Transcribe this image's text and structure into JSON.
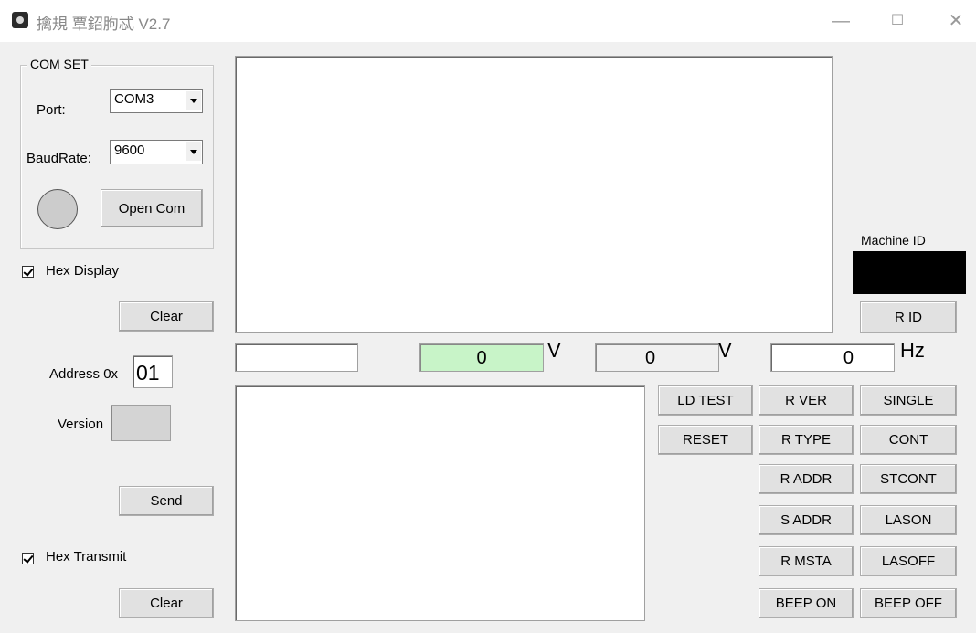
{
  "window": {
    "title": "擒規 覃鉊朐忒 V2.7",
    "min_glyph": "—",
    "max_glyph": "☐",
    "close_glyph": "✕"
  },
  "comset": {
    "group_title": "COM SET",
    "port_label": "Port:",
    "port_value": "COM3",
    "baud_label": "BaudRate:",
    "baud_value": "9600",
    "open_label": "Open Com"
  },
  "receive": {
    "hex_display_label": "Hex Display",
    "clear_label": "Clear",
    "text": ""
  },
  "device": {
    "address_label": "Address 0x",
    "address_value": "01",
    "version_label": "Version",
    "version_value": ""
  },
  "transmit": {
    "send_label": "Send",
    "hex_transmit_label": "Hex Transmit",
    "clear_label": "Clear",
    "text": ""
  },
  "readings": {
    "blank_value": "",
    "volt1_value": "0",
    "volt1_unit": "V",
    "volt2_value": "0",
    "volt2_unit": "V",
    "freq_value": "0",
    "freq_unit": "Hz"
  },
  "machine": {
    "id_label": "Machine ID",
    "rid_label": "R ID"
  },
  "commands": {
    "ld_test": "LD TEST",
    "reset": "RESET",
    "r_ver": "R VER",
    "r_type": "R TYPE",
    "r_addr": "R ADDR",
    "s_addr": "S ADDR",
    "r_msta": "R MSTA",
    "beep_on": "BEEP ON",
    "single": "SINGLE",
    "cont": "CONT",
    "stcont": "STCONT",
    "lason": "LASON",
    "lasoff": "LASOFF",
    "beep_off": "BEEP OFF"
  },
  "colors": {
    "volt1_bg": "#c8f4c8",
    "machine_id_bg": "#000000"
  }
}
